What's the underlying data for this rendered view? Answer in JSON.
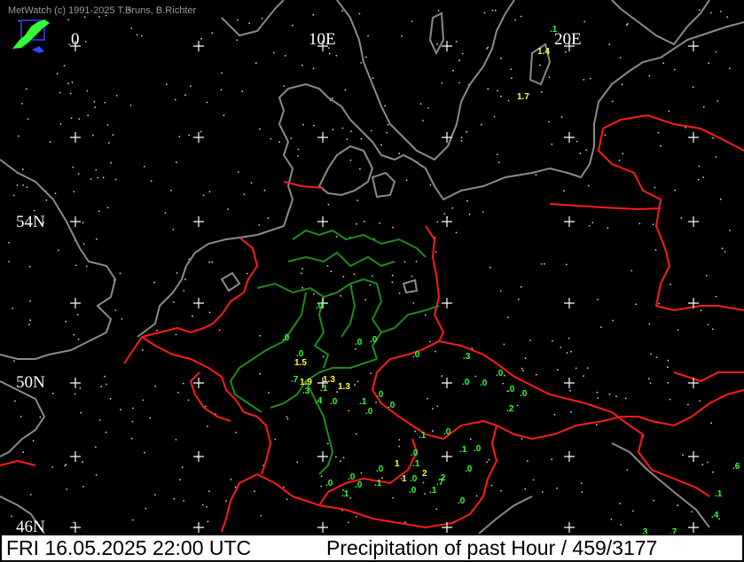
{
  "header": {
    "copyright": "MetWatch  (c) 1991-2025 T.Bruns, B.Richter"
  },
  "axes": {
    "lon_labels": [
      "0",
      "10E",
      "20E"
    ],
    "lat_labels": [
      "54N",
      "50N",
      "46N"
    ]
  },
  "footer": {
    "datetime": "FRI 16.05.2025 22:00 UTC",
    "title": "Precipitation of past  Hour  / 459/3177"
  },
  "observations": [
    {
      "v": ".1",
      "c": "green"
    },
    {
      "v": "1.4",
      "c": "yellow"
    },
    {
      "v": "1.7",
      "c": "yellow"
    },
    {
      "v": ".0",
      "c": "green"
    },
    {
      "v": ".0",
      "c": "green"
    },
    {
      "v": ".0",
      "c": "green"
    },
    {
      "v": ".0",
      "c": "green"
    },
    {
      "v": ".0",
      "c": "green"
    },
    {
      "v": "1.5",
      "c": "yellow"
    },
    {
      "v": ".0",
      "c": "green"
    },
    {
      "v": ".7",
      "c": "green"
    },
    {
      "v": "1.9",
      "c": "yellow"
    },
    {
      "v": "1.3",
      "c": "yellow"
    },
    {
      "v": "1.3",
      "c": "yellow"
    },
    {
      "v": ".3",
      "c": "green"
    },
    {
      "v": ".1",
      "c": "green"
    },
    {
      "v": ".4",
      "c": "green"
    },
    {
      "v": ".0",
      "c": "green"
    },
    {
      "v": ".3",
      "c": "green"
    },
    {
      "v": ".0",
      "c": "green"
    },
    {
      "v": ".0",
      "c": "green"
    },
    {
      "v": ".0",
      "c": "green"
    },
    {
      "v": ".0",
      "c": "green"
    },
    {
      "v": ".0",
      "c": "green"
    },
    {
      "v": ".0",
      "c": "green"
    },
    {
      "v": ".1",
      "c": "green"
    },
    {
      "v": ".0",
      "c": "green"
    },
    {
      "v": ".0",
      "c": "green"
    },
    {
      "v": ".2",
      "c": "green"
    },
    {
      "v": ".1",
      "c": "green"
    },
    {
      "v": ".0",
      "c": "green"
    },
    {
      "v": ".0",
      "c": "green"
    },
    {
      "v": ".1",
      "c": "green"
    },
    {
      "v": ".0",
      "c": "green"
    },
    {
      "v": ".1",
      "c": "green"
    },
    {
      "v": ".0",
      "c": "green"
    },
    {
      "v": ".0",
      "c": "green"
    },
    {
      "v": ".7",
      "c": "green"
    },
    {
      "v": "1",
      "c": "yellow"
    },
    {
      "v": "2",
      "c": "yellow"
    },
    {
      "v": "1",
      "c": "yellow"
    },
    {
      "v": ".2",
      "c": "green"
    },
    {
      "v": ".0",
      "c": "green"
    },
    {
      "v": ".0",
      "c": "green"
    },
    {
      "v": ".1",
      "c": "green"
    },
    {
      "v": ".0",
      "c": "green"
    },
    {
      "v": ".0",
      "c": "green"
    },
    {
      "v": ".1",
      "c": "green"
    },
    {
      "v": ".1",
      "c": "green"
    },
    {
      "v": ".0",
      "c": "green"
    },
    {
      "v": ".0",
      "c": "green"
    },
    {
      "v": ".6",
      "c": "green"
    },
    {
      "v": ".1",
      "c": "green"
    },
    {
      "v": ".4",
      "c": "green"
    },
    {
      "v": ".3",
      "c": "green"
    },
    {
      "v": ".7",
      "c": "green"
    }
  ],
  "colors": {
    "coast": "#8a8a8a",
    "border": "#ff1a1a",
    "region": "#1f8a1f",
    "obs_low": "#33ff33",
    "obs_high": "#ffff33"
  }
}
